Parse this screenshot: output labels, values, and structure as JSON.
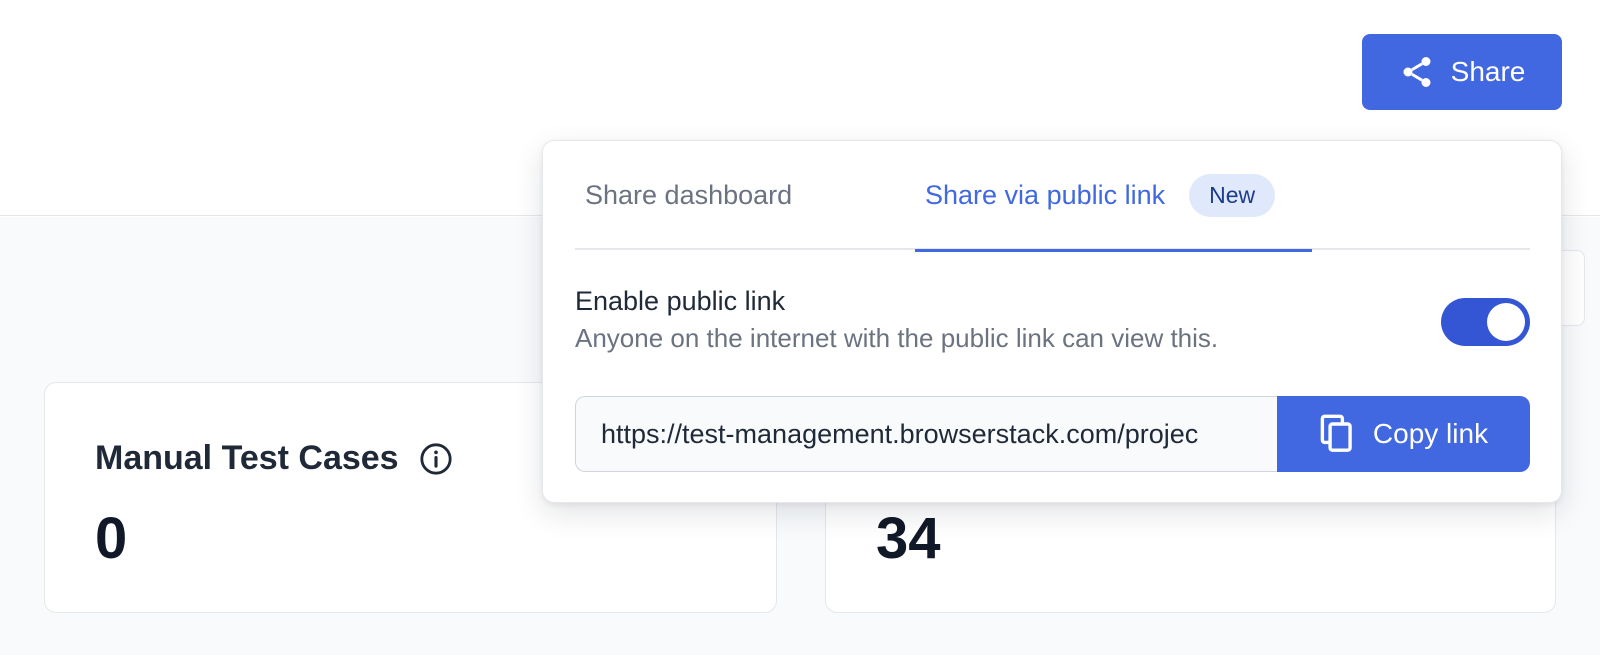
{
  "toolbar": {
    "share_label": "Share",
    "share_icon": "share-icon"
  },
  "cards": [
    {
      "title": "Manual Test Cases",
      "value": "0",
      "icon": "info-icon"
    },
    {
      "title": "",
      "value": "34"
    }
  ],
  "share_popover": {
    "tabs": [
      {
        "label": "Share dashboard",
        "active": false
      },
      {
        "label": "Share via public link",
        "active": true,
        "badge": "New"
      }
    ],
    "public_link": {
      "title": "Enable public link",
      "description": "Anyone on the internet with the public link can view this.",
      "enabled": true,
      "url": "https://test-management.browserstack.com/projec",
      "copy_label": "Copy link",
      "copy_icon": "copy-icon"
    }
  },
  "colors": {
    "accent": "#4168e0",
    "toggle_on": "#3556d4",
    "badge_bg": "#e0e9fb",
    "background": "#f8fafc"
  }
}
